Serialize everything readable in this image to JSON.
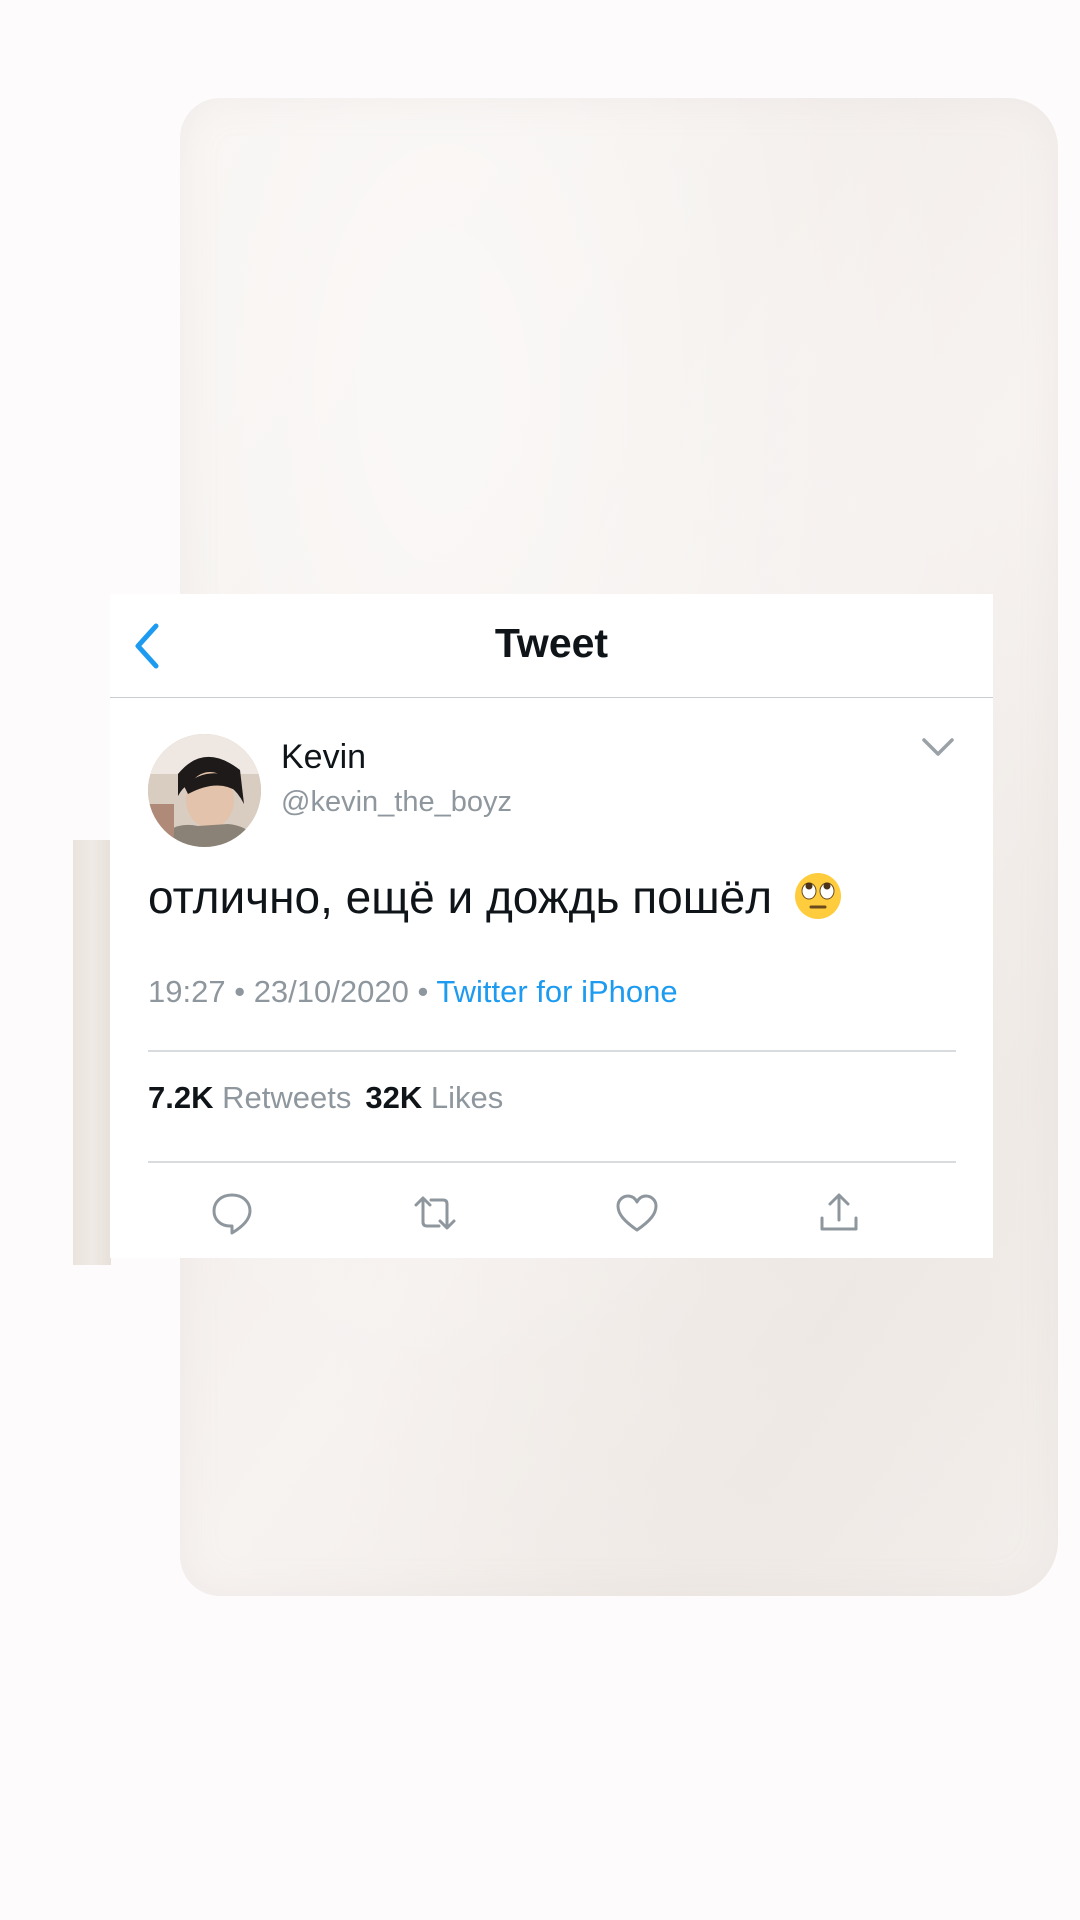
{
  "header": {
    "title": "Tweet"
  },
  "author": {
    "name": "Kevin",
    "handle": "@kevin_the_boyz"
  },
  "tweet": {
    "text": "отлично, ещё и дождь пошёл",
    "emoji_icon": "face-with-rolling-eyes-emoji",
    "time": "19:27",
    "date": "23/10/2020",
    "source": "Twitter for iPhone",
    "separator": "•"
  },
  "stats": {
    "retweets_count": "7.2K",
    "retweets_label": "Retweets",
    "likes_count": "32K",
    "likes_label": "Likes"
  },
  "colors": {
    "accent": "#1d9bf0",
    "text": "#0f1419",
    "muted": "#8f979e",
    "icons": "#8f979e"
  },
  "icons": [
    "chevron-left-icon",
    "chevron-down-icon",
    "reply-icon",
    "retweet-icon",
    "like-icon",
    "share-icon"
  ]
}
